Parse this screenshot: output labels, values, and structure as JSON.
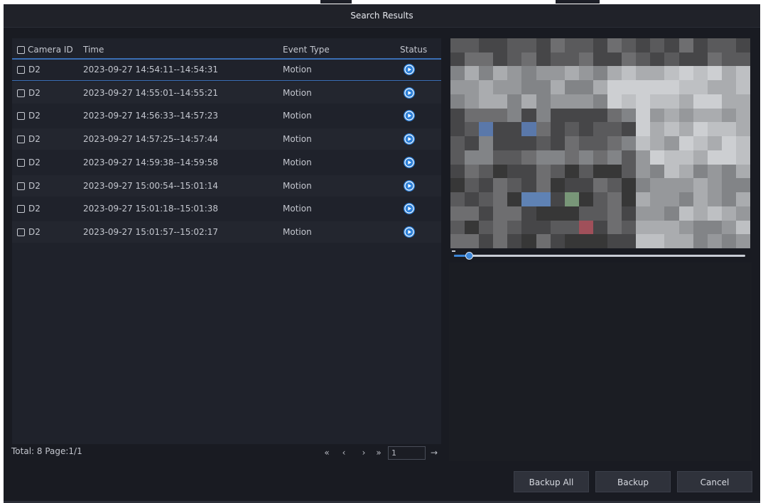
{
  "dialog": {
    "title": "Search Results"
  },
  "table": {
    "headers": {
      "camera_id": "Camera ID",
      "time": "Time",
      "event_type": "Event Type",
      "status": "Status"
    },
    "rows": [
      {
        "camera_id": "D2",
        "time": "2023-09-27 14:54:11--14:54:31",
        "event_type": "Motion",
        "status_icon": "play-icon"
      },
      {
        "camera_id": "D2",
        "time": "2023-09-27 14:55:01--14:55:21",
        "event_type": "Motion",
        "status_icon": "play-icon"
      },
      {
        "camera_id": "D2",
        "time": "2023-09-27 14:56:33--14:57:23",
        "event_type": "Motion",
        "status_icon": "play-icon"
      },
      {
        "camera_id": "D2",
        "time": "2023-09-27 14:57:25--14:57:44",
        "event_type": "Motion",
        "status_icon": "play-icon"
      },
      {
        "camera_id": "D2",
        "time": "2023-09-27 14:59:38--14:59:58",
        "event_type": "Motion",
        "status_icon": "play-icon"
      },
      {
        "camera_id": "D2",
        "time": "2023-09-27 15:00:54--15:01:14",
        "event_type": "Motion",
        "status_icon": "play-icon"
      },
      {
        "camera_id": "D2",
        "time": "2023-09-27 15:01:18--15:01:38",
        "event_type": "Motion",
        "status_icon": "play-icon"
      },
      {
        "camera_id": "D2",
        "time": "2023-09-27 15:01:57--15:02:17",
        "event_type": "Motion",
        "status_icon": "play-icon"
      }
    ]
  },
  "pager": {
    "summary": "Total: 8  Page:1/1",
    "first": "«",
    "prev": "‹",
    "next": "›",
    "last": "»",
    "page_value": "1",
    "go": "→"
  },
  "playback": {
    "progress": 0.05
  },
  "buttons": {
    "backup_all": "Backup All",
    "backup": "Backup",
    "cancel": "Cancel"
  },
  "colors": {
    "accent": "#2b7fd8",
    "dialog_bg": "#191b22"
  }
}
